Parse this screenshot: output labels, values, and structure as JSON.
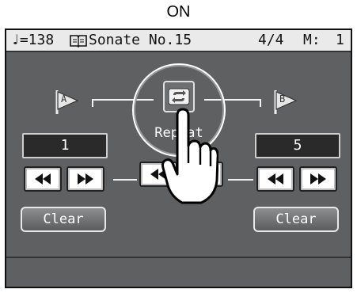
{
  "callout": {
    "label": "ON"
  },
  "status_bar": {
    "tempo": "♩=138",
    "song_title": "Sonate No.15",
    "time_signature": "4/4",
    "measure_label": "M:",
    "measure_value": "1"
  },
  "marker_a": {
    "flag_label": "A",
    "counter": "1",
    "clear_label": "Clear"
  },
  "marker_b": {
    "flag_label": "B",
    "counter": "5",
    "clear_label": "Clear"
  },
  "repeat": {
    "label": "Repeat",
    "state": "on"
  },
  "icons": {
    "rewind": "rewind-icon",
    "fast_forward": "fast-forward-icon",
    "repeat": "repeat-icon",
    "book": "score-book-icon",
    "note": "quarter-note-icon",
    "hand": "pointing-hand-icon"
  },
  "colors": {
    "screen_bg": "#5e6062",
    "status_bar_bg": "#eaeaea",
    "counter_bg": "#2a2a2a"
  }
}
